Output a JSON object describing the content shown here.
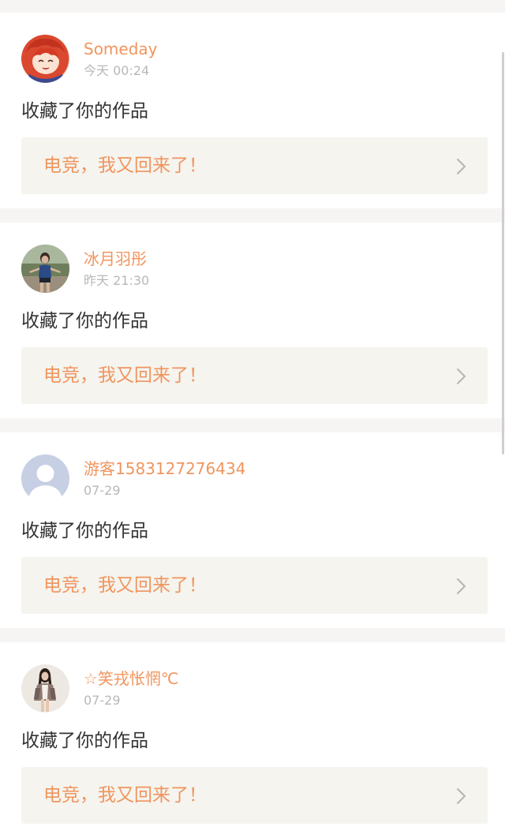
{
  "notifications": [
    {
      "username": "Someday",
      "time": "今天 00:24",
      "action": "收藏了你的作品",
      "work_title": "电竞，我又回来了！",
      "avatar_icon": "anime-girl-avatar-icon"
    },
    {
      "username": "冰月羽彤",
      "time": "昨天 21:30",
      "action": "收藏了你的作品",
      "work_title": "电竞，我又回来了！",
      "avatar_icon": "person-photo-avatar-icon"
    },
    {
      "username": "游客1583127276434",
      "time": "07-29",
      "action": "收藏了你的作品",
      "work_title": "电竞，我又回来了！",
      "avatar_icon": "default-user-avatar-icon"
    },
    {
      "username": "☆笑戎怅惘℃",
      "time": "07-29",
      "action": "收藏了你的作品",
      "work_title": "电竞，我又回来了！",
      "avatar_icon": "woman-photo-avatar-icon"
    }
  ],
  "colors": {
    "accent": "#f0955e",
    "page_background": "#f7f5f4",
    "card_background": "#ffffff",
    "work_box_background": "#f5f4ef",
    "timestamp": "#b8b8b8",
    "body_text": "#333333",
    "chevron": "#b5b5b5"
  },
  "icons": {
    "chevron": "chevron-right-icon"
  }
}
